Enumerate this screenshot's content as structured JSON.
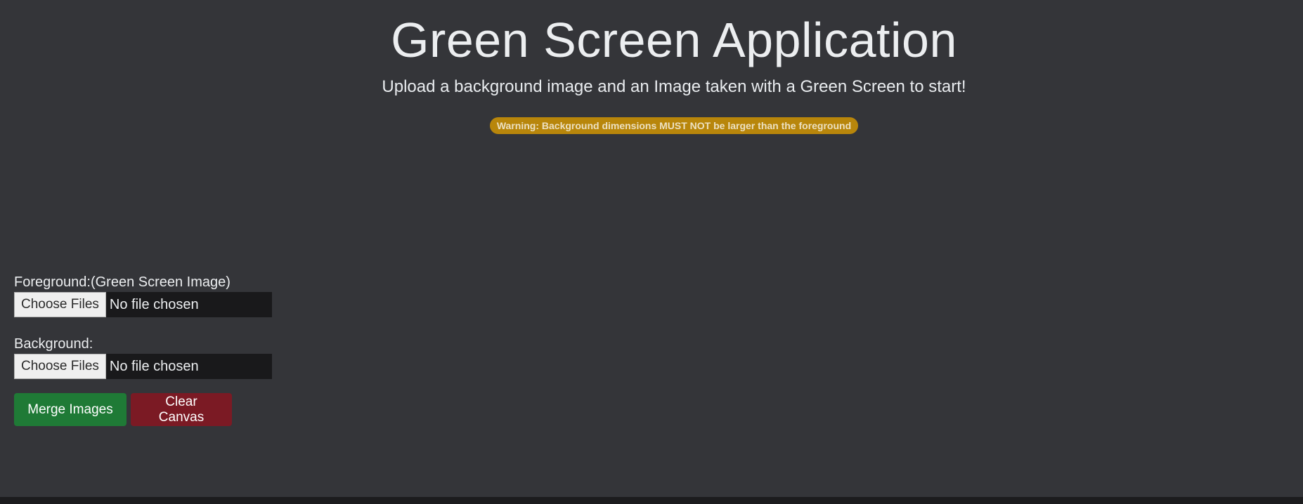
{
  "header": {
    "title": "Green Screen Application",
    "subtitle": "Upload a background image and an Image taken with a Green Screen to start!",
    "warning": "Warning: Background dimensions MUST NOT be larger than the foreground"
  },
  "form": {
    "foreground": {
      "label": "Foreground:(Green Screen Image)",
      "button_label": "Choose Files",
      "status": "No file chosen"
    },
    "background": {
      "label": "Background:",
      "button_label": "Choose Files",
      "status": "No file chosen"
    }
  },
  "actions": {
    "merge_label": "Merge Images",
    "clear_label": "Clear Canvas"
  },
  "colors": {
    "page_background": "#343539",
    "warning": "#b8860b",
    "merge": "#1f7a36",
    "clear": "#7b1a24"
  }
}
